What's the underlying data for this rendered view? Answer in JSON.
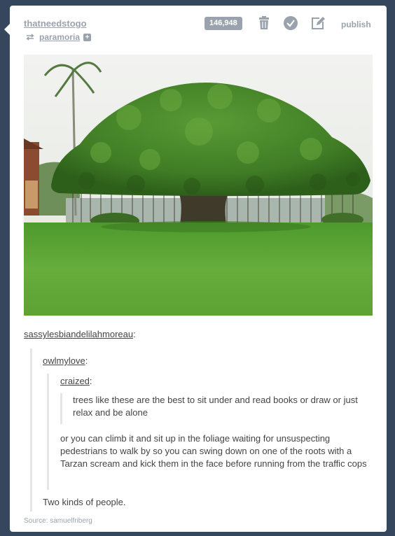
{
  "header": {
    "username": "thatneedstogo",
    "reblogged_from": "paramoria",
    "notes_count": "146,948",
    "publish_label": "publish"
  },
  "icons": {
    "reblog": "reblog-icon",
    "follow": "plus-icon",
    "delete": "trash-icon",
    "check": "checkmark-icon",
    "edit": "edit-icon"
  },
  "colors": {
    "dashboard_bg": "#36465d",
    "meta_gray": "#9aa3ad"
  },
  "post": {
    "photo_alt": "banyan tree on a lawn",
    "chain": {
      "user1": "sassylesbiandelilahmoreau",
      "user2": "owlmylove",
      "user3": "craized",
      "text3": "trees like these are the best to sit under and read books or draw or just relax and be alone",
      "text2": "or you can climb it and sit up in the foliage waiting for unsuspecting pedestrians to walk by so you can swing down on one of the roots with a Tarzan scream and kick them in the face before running from the traffic cops",
      "text1": "Two kinds of people."
    },
    "source": "Source: samuelfriberg"
  }
}
